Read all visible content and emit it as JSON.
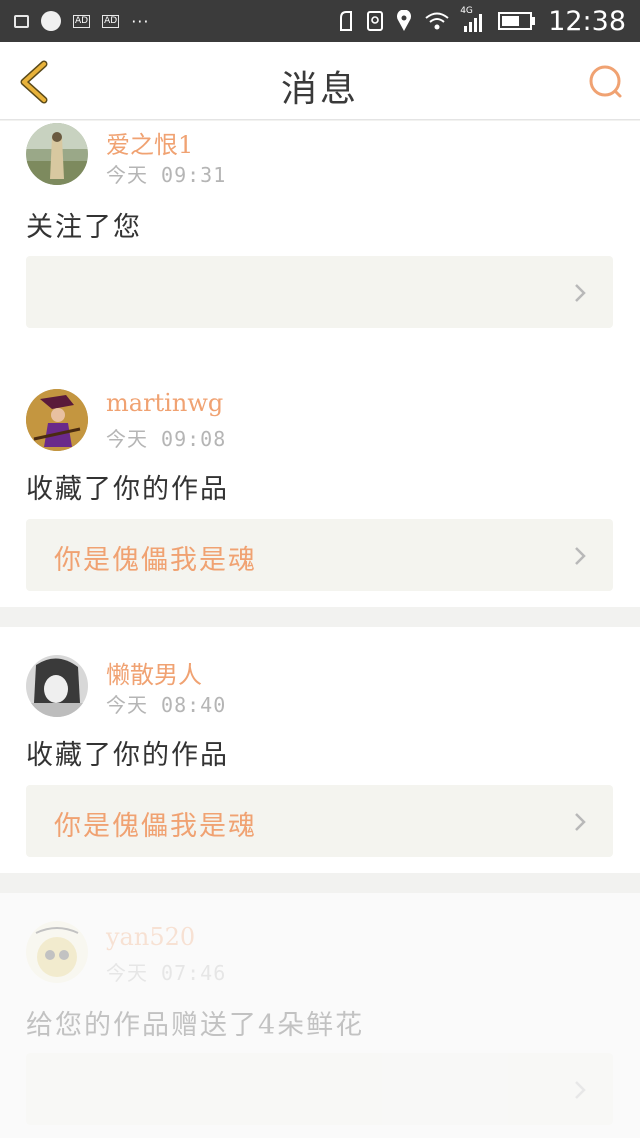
{
  "status_bar": {
    "time": "12:38",
    "network": "4G",
    "ad_label": "AD",
    "dots": "···"
  },
  "nav": {
    "title": "消息"
  },
  "messages": [
    {
      "username": "爱之恨1",
      "time": "今天 09:31",
      "action": "关注了您",
      "work_title": ""
    },
    {
      "username": "martinwg",
      "time": "今天 09:08",
      "action": "收藏了你的作品",
      "work_title": "你是傀儡我是魂"
    },
    {
      "username": "懒散男人",
      "time": "今天 08:40",
      "action": "收藏了你的作品",
      "work_title": "你是傀儡我是魂"
    },
    {
      "username": "yan520",
      "time": "今天 07:46",
      "action": "给您的作品赠送了4朵鲜花",
      "work_title": ""
    }
  ],
  "colors": {
    "accent": "#f0a272",
    "back_arrow": "#e8b23a",
    "status_bar": "#3b3b3b"
  }
}
